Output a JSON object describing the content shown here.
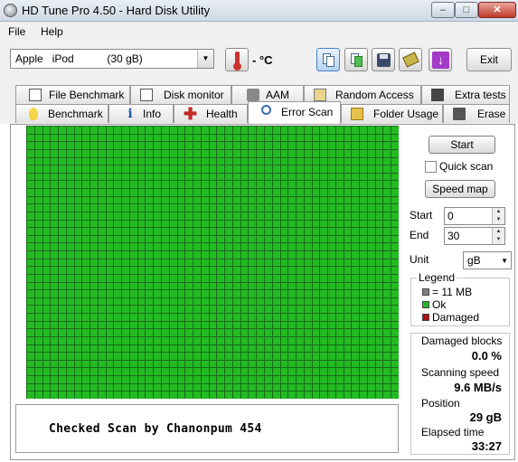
{
  "window": {
    "title": "HD Tune Pro 4.50 - Hard Disk Utility"
  },
  "menu": {
    "items": [
      {
        "label": "File"
      },
      {
        "label": "Help"
      }
    ]
  },
  "toolbar": {
    "drive": "Apple   iPod           (30 gB)",
    "temperature": "- °C",
    "exit_label": "Exit"
  },
  "tabs": {
    "row1": [
      {
        "label": "File Benchmark",
        "icon": "file-benchmark-icon"
      },
      {
        "label": "Disk monitor",
        "icon": "disk-monitor-icon"
      },
      {
        "label": "AAM",
        "icon": "speaker-icon"
      },
      {
        "label": "Random Access",
        "icon": "random-access-icon"
      },
      {
        "label": "Extra tests",
        "icon": "extra-tests-icon"
      }
    ],
    "row2": [
      {
        "label": "Benchmark",
        "icon": "lightbulb-icon"
      },
      {
        "label": "Info",
        "icon": "info-icon"
      },
      {
        "label": "Health",
        "icon": "health-cross-icon"
      },
      {
        "label": "Error Scan",
        "icon": "magnifier-icon",
        "active": true
      },
      {
        "label": "Folder Usage",
        "icon": "folder-icon"
      },
      {
        "label": "Erase",
        "icon": "trash-icon"
      }
    ]
  },
  "scan": {
    "start_button": "Start",
    "quick_scan_label": "Quick scan",
    "quick_scan_checked": false,
    "speed_map_button": "Speed map",
    "start_label": "Start",
    "start_value": "0",
    "end_label": "End",
    "end_value": "30",
    "unit_label": "Unit",
    "unit_value": "gB",
    "legend": {
      "title": "Legend",
      "block_size": "= 11 MB",
      "ok": "Ok",
      "damaged": "Damaged"
    },
    "stats": {
      "damaged_blocks_label": "Damaged blocks",
      "damaged_blocks_value": "0.0 %",
      "scanning_speed_label": "Scanning speed",
      "scanning_speed_value": "9.6 MB/s",
      "position_label": "Position",
      "position_value": "29 gB",
      "elapsed_label": "Elapsed time",
      "elapsed_value": "33:27"
    },
    "note": "Checked Scan by Chanonpum 454",
    "grid": {
      "columns": 47,
      "rows": 35,
      "ok_color": "#22bb22",
      "line_color": "#1d6a1d"
    }
  },
  "colors": {
    "legend_block": "#808080",
    "legend_ok": "#22bb22",
    "legend_damaged": "#b01010"
  }
}
